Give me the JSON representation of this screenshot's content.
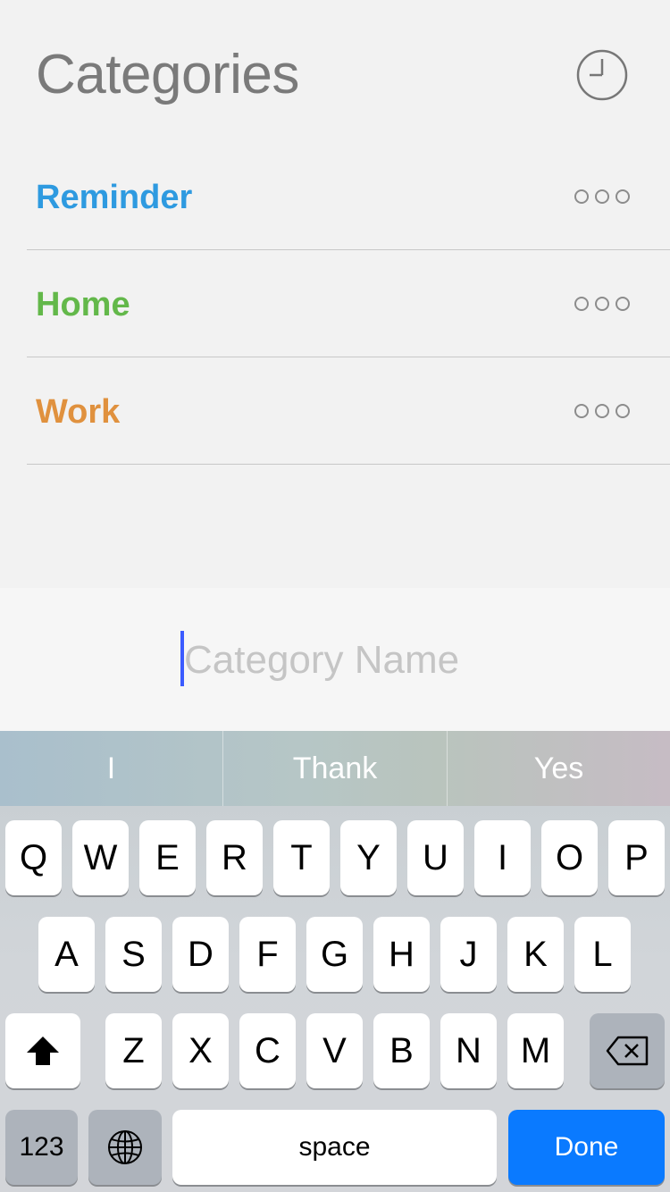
{
  "header": {
    "title": "Categories",
    "history_icon": "clock-icon"
  },
  "categories": [
    {
      "label": "Reminder",
      "color": "#2e9ae0",
      "more_icon": "more-dots-icon"
    },
    {
      "label": "Home",
      "color": "#63b84a",
      "more_icon": "more-dots-icon"
    },
    {
      "label": "Work",
      "color": "#e0913e",
      "more_icon": "more-dots-icon"
    }
  ],
  "input": {
    "placeholder": "Category Name",
    "value": ""
  },
  "suggestions": [
    "I",
    "Thank",
    "Yes"
  ],
  "keyboard": {
    "row1": [
      "Q",
      "W",
      "E",
      "R",
      "T",
      "Y",
      "U",
      "I",
      "O",
      "P"
    ],
    "row2": [
      "A",
      "S",
      "D",
      "F",
      "G",
      "H",
      "J",
      "K",
      "L"
    ],
    "row3": [
      "Z",
      "X",
      "C",
      "V",
      "B",
      "N",
      "M"
    ],
    "numbers_label": "123",
    "space_label": "space",
    "done_label": "Done",
    "shift_icon": "shift-arrow-icon",
    "globe_icon": "globe-icon",
    "delete_icon": "backspace-icon"
  },
  "colors": {
    "accent": "#0a7aff",
    "caret": "#3b5bff"
  }
}
